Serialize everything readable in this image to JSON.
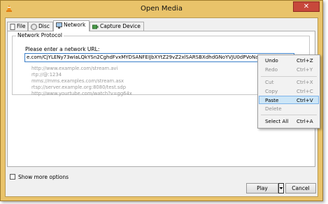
{
  "window": {
    "title": "Open Media",
    "close_glyph": "✕"
  },
  "tabs": [
    {
      "label": "File",
      "icon": "file-icon"
    },
    {
      "label": "Disc",
      "icon": "disc-icon"
    },
    {
      "label": "Network",
      "icon": "network-icon"
    },
    {
      "label": "Capture Device",
      "icon": "capture-device-icon"
    }
  ],
  "network": {
    "group_title": "Network Protocol",
    "url_label": "Please enter a network URL:",
    "url_value": "e.com/CjYLENy73wIaLQkYSn2CghdFvxMYDSANFEIJbXYtZ29vZ2xlSARSBXdhdGNoYVJU0dPVoNaXUAw=/0/",
    "url_selected_tail": "0/",
    "examples": [
      "http://www.example.com/stream.avi",
      "rtp://@:1234",
      "mms://mms.examples.com/stream.asx",
      "rtsp://server.example.org:8080/test.sdp",
      "http://www.yourtube.com/watch?v=gg64x"
    ]
  },
  "show_more": {
    "label": "Show more options",
    "checked": false
  },
  "buttons": {
    "play": "Play",
    "cancel": "Cancel"
  },
  "context_menu": {
    "items": [
      {
        "label": "Undo",
        "shortcut": "Ctrl+Z",
        "enabled": true
      },
      {
        "label": "Redo",
        "shortcut": "Ctrl+Y",
        "enabled": false
      },
      {
        "label": "Cut",
        "shortcut": "Ctrl+X",
        "enabled": false
      },
      {
        "label": "Copy",
        "shortcut": "Ctrl+C",
        "enabled": false
      },
      {
        "label": "Paste",
        "shortcut": "Ctrl+V",
        "enabled": true,
        "highlighted": true
      },
      {
        "label": "Delete",
        "shortcut": "",
        "enabled": false
      },
      {
        "label": "Select All",
        "shortcut": "Ctrl+A",
        "enabled": true
      }
    ]
  }
}
